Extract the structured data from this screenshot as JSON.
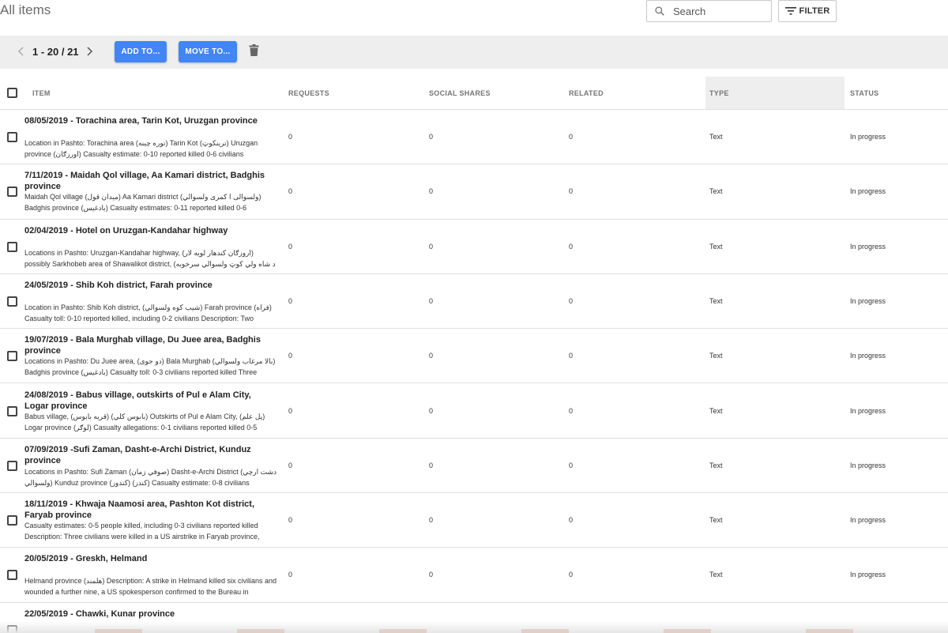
{
  "header": {
    "title": "All items",
    "search_placeholder": "Search",
    "filter_label": "FILTER"
  },
  "toolbar": {
    "pager": "1 - 20 / 21",
    "add_label": "ADD TO...",
    "move_label": "MOVE TO..."
  },
  "columns": {
    "item": "ITEM",
    "requests": "REQUESTS",
    "social_shares": "SOCIAL SHARES",
    "related": "RELATED",
    "type": "TYPE",
    "status": "STATUS"
  },
  "rows": [
    {
      "title": "08/05/2019 - Torachina area, Tarin Kot, Uruzgan province",
      "desc": "Location in Pashto: Torachina area (توره چینه) Tarin Kot (ترینکوټ) Uruzgan province (اورزګان) Casualty estimate: 0-10 reported killed 0-6 civilians",
      "requests": "0",
      "social_shares": "0",
      "related": "0",
      "type": "Text",
      "status": "In progress"
    },
    {
      "title": "7/11/2019 - Maidah Qol village, Aa Kamari district, Badghis province",
      "desc": "Maidah Qol village (میدان قول) Aa Kamari district (ولسوالی ا کمری ولسوالي) Badghis province (بادغیس) Casualty estimates: 0-11 reported killed 0-6",
      "requests": "0",
      "social_shares": "0",
      "related": "0",
      "type": "Text",
      "status": "In progress"
    },
    {
      "title": "02/04/2019 - Hotel on Uruzgan-Kandahar highway",
      "desc": "Locations in Pashto: Uruzgan-Kandahar highway, (اروزګان کندهار لویه لار) possibly Sarkhobeb area of Shawalikot district, (د شاه ولي کوټ ولسوالي سرخوبه",
      "requests": "0",
      "social_shares": "0",
      "related": "0",
      "type": "Text",
      "status": "In progress"
    },
    {
      "title": "24/05/2019 - Shib Koh district, Farah province",
      "desc": "Location in Pashto: Shib Koh district, (شیب کوه ولسوالي) Farah province (فراه) Casualty toll: 0-10 reported killed, including 0-2 civilians Description: Two",
      "requests": "0",
      "social_shares": "0",
      "related": "0",
      "type": "Text",
      "status": "In progress"
    },
    {
      "title": "19/07/2019 - Bala Murghab village, Du Juee area, Badghis province",
      "desc": "Locations in Pashto: Du Juee area, (دو جوی) Bala Murghab (بالا مرغاب ولسوالي) Badghis province (بادغیس) Casualty toll: 0-3 civilians reported killed Three",
      "requests": "0",
      "social_shares": "0",
      "related": "0",
      "type": "Text",
      "status": "In progress"
    },
    {
      "title": "24/08/2019 - Babus village, outskirts of Pul e Alam City, Logar province",
      "desc": "Babus village, (قریه بابوس) (بابوس کلي) Outskirts of Pul e Alam City, (پل علم) Logar province (لوګر) Casualty allegations: 0-1 civilians reported killed 0-5",
      "requests": "0",
      "social_shares": "0",
      "related": "0",
      "type": "Text",
      "status": "In progress"
    },
    {
      "title": "07/09/2019 -Sufi Zaman, Dasht-e-Archi District, Kunduz province",
      "desc": "Locations in Pashto: Sufi Zaman (صوفي زمان) Dasht-e-Archi District (دشت ارچي ولسوالي) Kunduz province (کندوز) (کندز) Casualty estimate: 0-8 civilians",
      "requests": "0",
      "social_shares": "0",
      "related": "0",
      "type": "Text",
      "status": "In progress"
    },
    {
      "title": "18/11/2019 - Khwaja Naamosi area, Pashton Kot district, Faryab province",
      "desc": "Casualty estimates: 0-5 people killed, including 0-3 civilians reported killed Description: Three civilians were killed in a US airstrike in Faryab province,",
      "requests": "0",
      "social_shares": "0",
      "related": "0",
      "type": "Text",
      "status": "In progress"
    },
    {
      "title": "20/05/2019 - Greskh, Helmand",
      "desc": "Helmand province (هلمند) Description: A strike in Helmand killed six civilians and wounded a further nine, a US spokesperson confirmed to the Bureau in",
      "requests": "0",
      "social_shares": "0",
      "related": "0",
      "type": "Text",
      "status": "In progress"
    },
    {
      "title": "22/05/2019 - Chawki, Kunar province",
      "desc": "",
      "requests": "",
      "social_shares": "",
      "related": "",
      "type": "",
      "status": ""
    }
  ]
}
